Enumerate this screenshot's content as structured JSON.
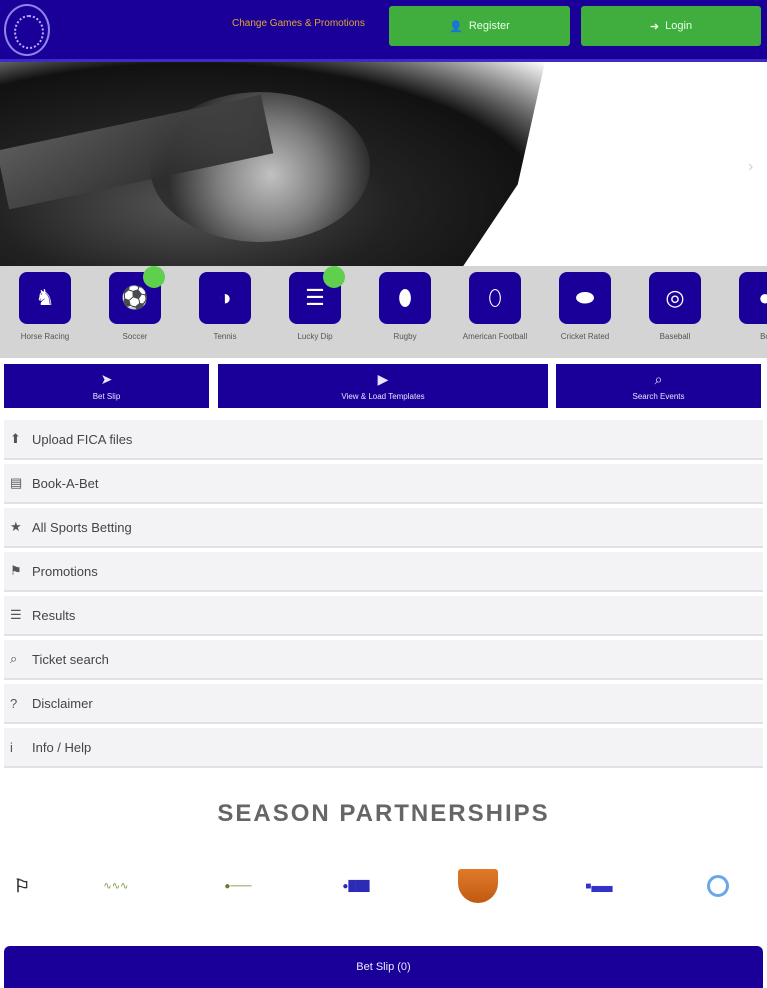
{
  "header": {
    "promo_text": "Change Games & Promotions",
    "register_label": "Register",
    "login_label": "Login",
    "register_icon": "user-plus-icon",
    "login_icon": "sign-in-icon",
    "bg_color": "#1a0099",
    "button_color": "#3fae3f"
  },
  "hero": {
    "arrow_icon": "chevron-right-icon"
  },
  "sports": [
    {
      "label": "Horse Racing",
      "icon": "horse-icon"
    },
    {
      "label": "Soccer",
      "icon": "soccer-icon"
    },
    {
      "label": "Tennis",
      "icon": "tennis-icon"
    },
    {
      "label": "Lucky Dip",
      "icon": "lucky-dip-icon"
    },
    {
      "label": "Rugby",
      "icon": "rugby-icon"
    },
    {
      "label": "American Football",
      "icon": "football-icon"
    },
    {
      "label": "Cricket Rated",
      "icon": "cricket-icon"
    },
    {
      "label": "Baseball",
      "icon": "baseball-icon"
    },
    {
      "label": "Bo",
      "icon": "boxing-icon"
    }
  ],
  "actions": [
    {
      "label": "Bet Slip",
      "icon": "send-icon"
    },
    {
      "label": "View & Load Templates",
      "icon": "play-icon"
    },
    {
      "label": "Search Events",
      "icon": "search-icon"
    }
  ],
  "menu": [
    {
      "label": "Upload FICA files",
      "icon": "upload-icon"
    },
    {
      "label": "Book-A-Bet",
      "icon": "book-icon"
    },
    {
      "label": "All Sports Betting",
      "icon": "trophy-icon"
    },
    {
      "label": "Promotions",
      "icon": "tag-icon"
    },
    {
      "label": "Results",
      "icon": "list-icon"
    },
    {
      "label": "Ticket search",
      "icon": "search-icon"
    },
    {
      "label": "Disclaimer",
      "icon": "question-icon"
    },
    {
      "label": "Info / Help",
      "icon": "info-icon"
    }
  ],
  "partners": {
    "title": "SEASON PARTNERSHIPS"
  },
  "footer": {
    "label": "Bet Slip (0)"
  }
}
